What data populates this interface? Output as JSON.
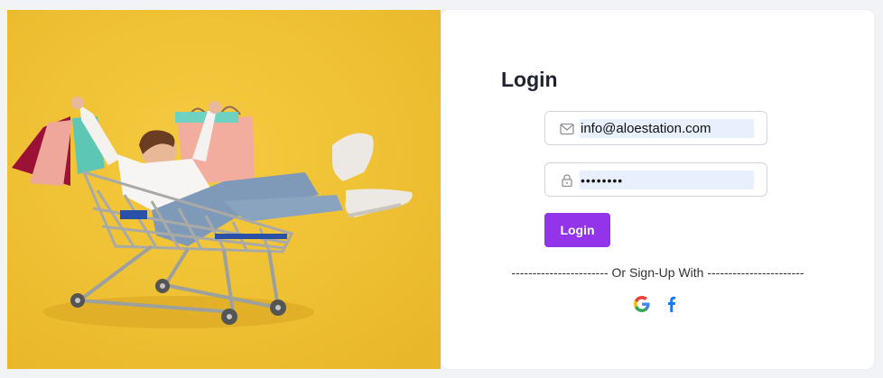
{
  "hero": {
    "image": "woman-in-shopping-cart-illustration",
    "background_color": "#eebf32"
  },
  "login": {
    "title": "Login",
    "email": {
      "value": "info@aloestation.com",
      "icon": "mail-icon"
    },
    "password": {
      "value": "••••••••",
      "icon": "lock-icon"
    },
    "button_label": "Login",
    "divider_text": "----------------------- Or Sign-Up With -----------------------",
    "social": [
      {
        "name": "Google",
        "icon": "google-icon"
      },
      {
        "name": "Facebook",
        "icon": "facebook-icon"
      }
    ]
  },
  "colors": {
    "accent": "#9333ea",
    "autofill": "#e8f0fe",
    "page_background": "#f1f3f6",
    "facebook": "#1877f2"
  }
}
